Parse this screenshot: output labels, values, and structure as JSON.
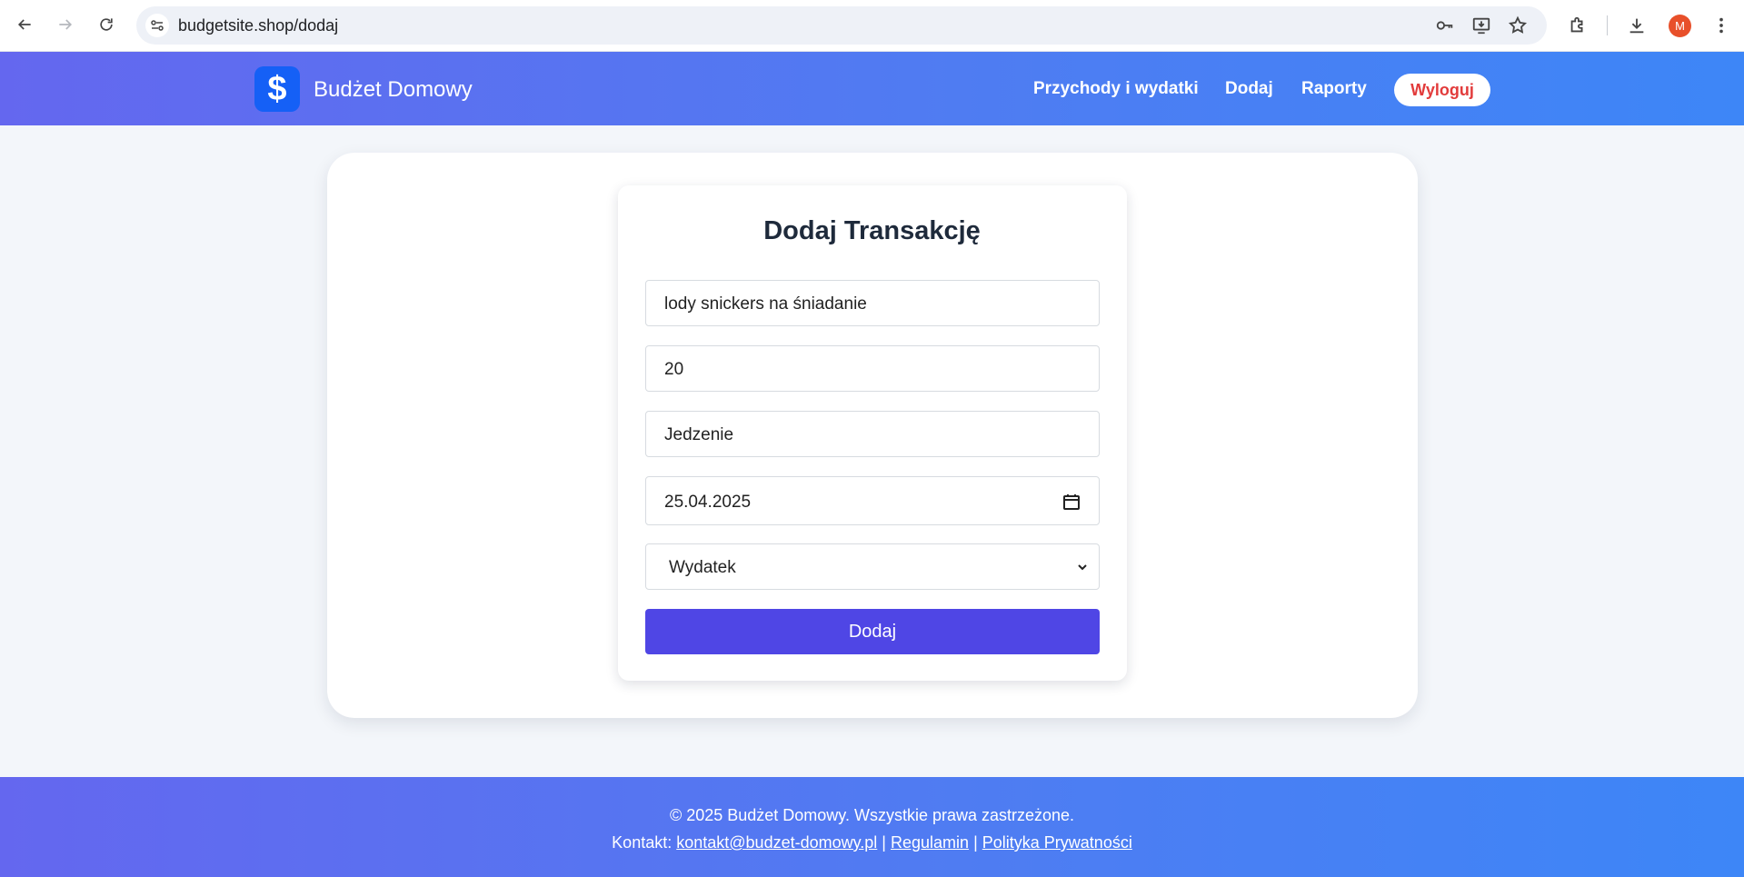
{
  "browser": {
    "url": "budgetsite.shop/dodaj",
    "profile_initial": "M"
  },
  "header": {
    "logo_symbol": "$",
    "brand": "Budżet Domowy",
    "nav": {
      "transactions": "Przychody i wydatki",
      "add": "Dodaj",
      "reports": "Raporty",
      "logout": "Wyloguj"
    }
  },
  "form": {
    "title": "Dodaj Transakcję",
    "description_value": "lody snickers na śniadanie",
    "amount_value": "20",
    "category_value": "Jedzenie",
    "date_value": "25.04.2025",
    "type_selected": "Wydatek",
    "submit_label": "Dodaj"
  },
  "footer": {
    "copyright": "© 2025 Budżet Domowy. Wszystkie prawa zastrzeżone.",
    "contact_label": "Kontakt:",
    "email": "kontakt@budzet-domowy.pl",
    "sep1": "|",
    "terms": "Regulamin",
    "sep2": "|",
    "privacy": "Polityka Prywatności"
  },
  "colors": {
    "accent": "#4f46e5",
    "header_gradient_start": "#6467ef",
    "header_gradient_end": "#3d86f7",
    "logout_text": "#e23b3b",
    "avatar": "#e8502a"
  }
}
